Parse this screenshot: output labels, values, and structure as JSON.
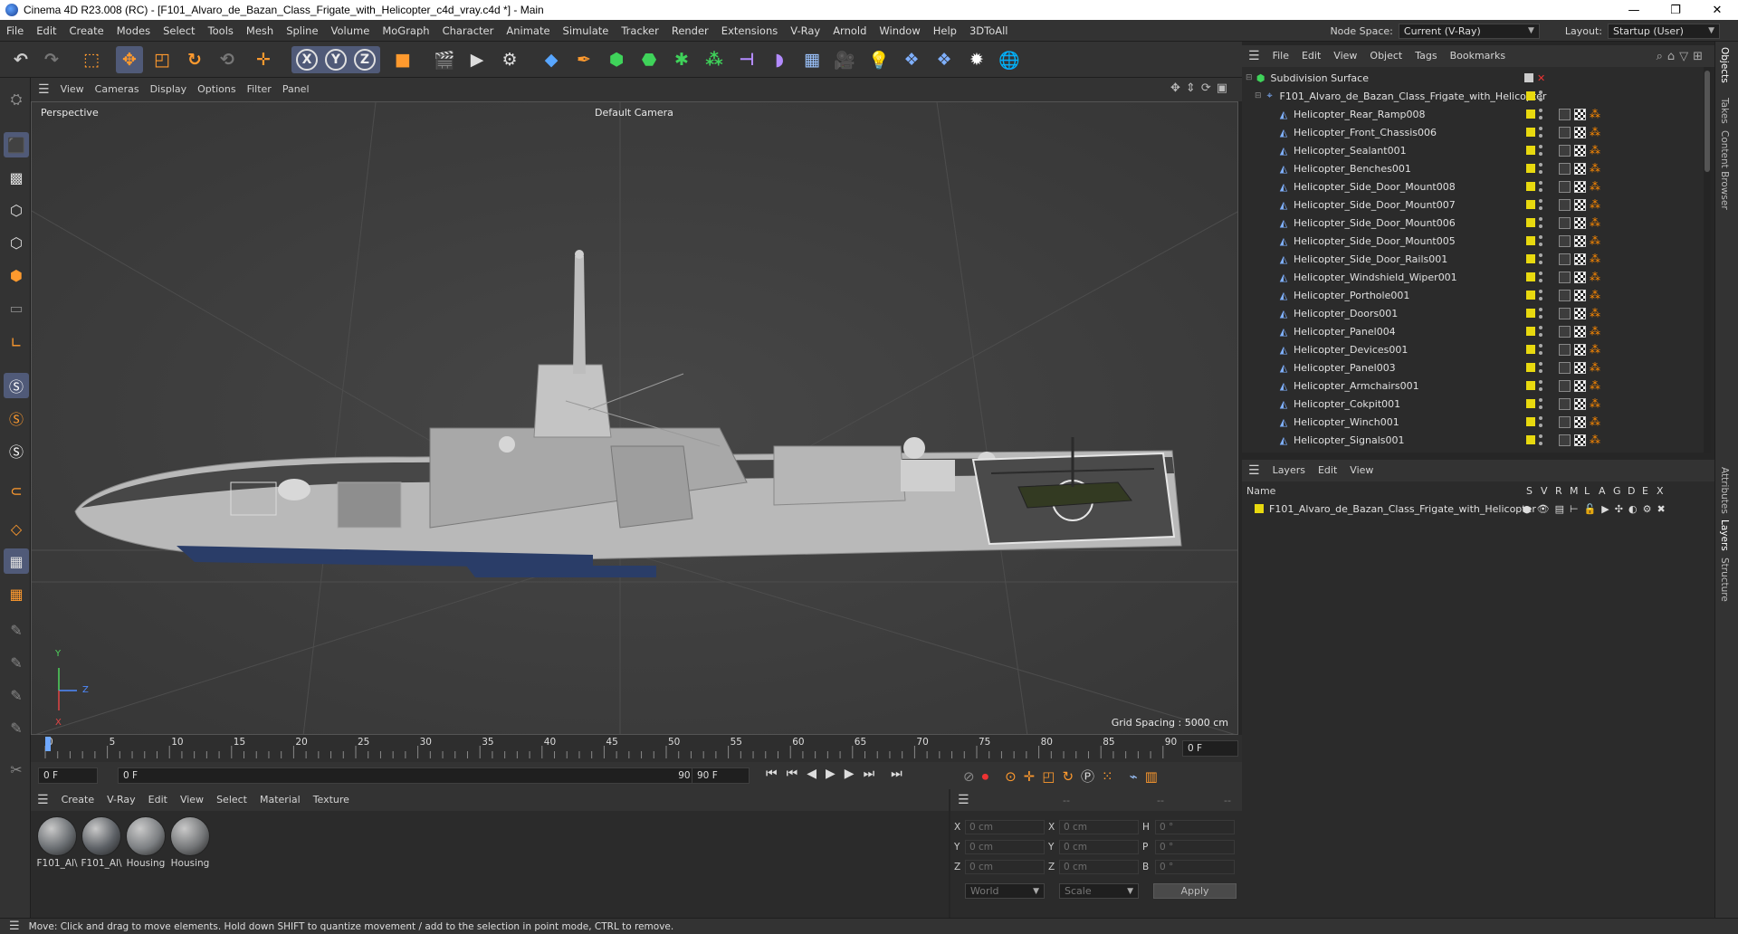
{
  "window": {
    "title": "Cinema 4D R23.008 (RC) - [F101_Alvaro_de_Bazan_Class_Frigate_with_Helicopter_c4d_vray.c4d *] - Main",
    "minimize": "—",
    "maximize": "❐",
    "close": "✕"
  },
  "menubar": {
    "items": [
      "File",
      "Edit",
      "Create",
      "Modes",
      "Select",
      "Tools",
      "Mesh",
      "Spline",
      "Volume",
      "MoGraph",
      "Character",
      "Animate",
      "Simulate",
      "Tracker",
      "Render",
      "Extensions",
      "V-Ray",
      "Arnold",
      "Window",
      "Help",
      "3DToAll"
    ],
    "node_space_label": "Node Space:",
    "node_space_value": "Current (V-Ray)",
    "layout_label": "Layout:",
    "layout_value": "Startup (User)"
  },
  "toolbar": {
    "axis_x": "X",
    "axis_y": "Y",
    "axis_z": "Z"
  },
  "viewport": {
    "menu": [
      "View",
      "Cameras",
      "Display",
      "Options",
      "Filter",
      "Panel"
    ],
    "view_name": "Perspective",
    "camera_name": "Default Camera",
    "grid_spacing": "Grid Spacing : 5000 cm",
    "axis_y": "Y",
    "axis_z": "Z",
    "axis_x": "X"
  },
  "timeline": {
    "ticks": [
      "0",
      "5",
      "10",
      "15",
      "20",
      "25",
      "30",
      "35",
      "40",
      "45",
      "50",
      "55",
      "60",
      "65",
      "70",
      "75",
      "80",
      "85",
      "90"
    ],
    "current_frame_right": "0 F",
    "start_field": "0 F",
    "range_start": "0 F",
    "range_end": "90 F",
    "end_field": "90 F"
  },
  "materials": {
    "menu": [
      "Create",
      "V-Ray",
      "Edit",
      "View",
      "Select",
      "Material",
      "Texture"
    ],
    "items": [
      {
        "name": "F101_Al\\",
        "color": "#6a6e72"
      },
      {
        "name": "F101_Al\\",
        "color": "#5d6166"
      },
      {
        "name": "Housing",
        "color": "#7c7f82"
      },
      {
        "name": "Housing",
        "color": "#747678"
      }
    ]
  },
  "coordinates": {
    "menu_dash1": "--",
    "menu_dash2": "--",
    "menu_dash3": "--",
    "rows": [
      {
        "l1": "X",
        "v1": "0 cm",
        "l2": "X",
        "v2": "0 cm",
        "l3": "H",
        "v3": "0 °"
      },
      {
        "l1": "Y",
        "v1": "0 cm",
        "l2": "Y",
        "v2": "0 cm",
        "l3": "P",
        "v3": "0 °"
      },
      {
        "l1": "Z",
        "v1": "0 cm",
        "l2": "Z",
        "v2": "0 cm",
        "l3": "B",
        "v3": "0 °"
      }
    ],
    "world": "World",
    "scale": "Scale",
    "apply": "Apply"
  },
  "objects": {
    "menu": [
      "File",
      "Edit",
      "View",
      "Object",
      "Tags",
      "Bookmarks"
    ],
    "root": "Subdivision Surface",
    "group": "F101_Alvaro_de_Bazan_Class_Frigate_with_Helicopter",
    "children": [
      "Helicopter_Rear_Ramp008",
      "Helicopter_Front_Chassis006",
      "Helicopter_Sealant001",
      "Helicopter_Benches001",
      "Helicopter_Side_Door_Mount008",
      "Helicopter_Side_Door_Mount007",
      "Helicopter_Side_Door_Mount006",
      "Helicopter_Side_Door_Mount005",
      "Helicopter_Side_Door_Rails001",
      "Helicopter_Windshield_Wiper001",
      "Helicopter_Porthole001",
      "Helicopter_Doors001",
      "Helicopter_Panel004",
      "Helicopter_Devices001",
      "Helicopter_Panel003",
      "Helicopter_Armchairs001",
      "Helicopter_Cokpit001",
      "Helicopter_Winch001",
      "Helicopter_Signals001"
    ]
  },
  "layers": {
    "menu": [
      "Layers",
      "Edit",
      "View"
    ],
    "name_header": "Name",
    "flags": [
      "S",
      "V",
      "R",
      "M",
      "L",
      "A",
      "G",
      "D",
      "E",
      "X"
    ],
    "items": [
      {
        "name": "F101_Alvaro_de_Bazan_Class_Frigate_with_Helicopter",
        "color": "#e8d90f"
      }
    ]
  },
  "right_tabs": [
    "Objects",
    "Takes",
    "Content Browser",
    "Attributes",
    "Layers",
    "Structure"
  ],
  "status": {
    "text": "Move: Click and drag to move elements. Hold down SHIFT to quantize movement / add to the selection in point mode, CTRL to remove."
  }
}
